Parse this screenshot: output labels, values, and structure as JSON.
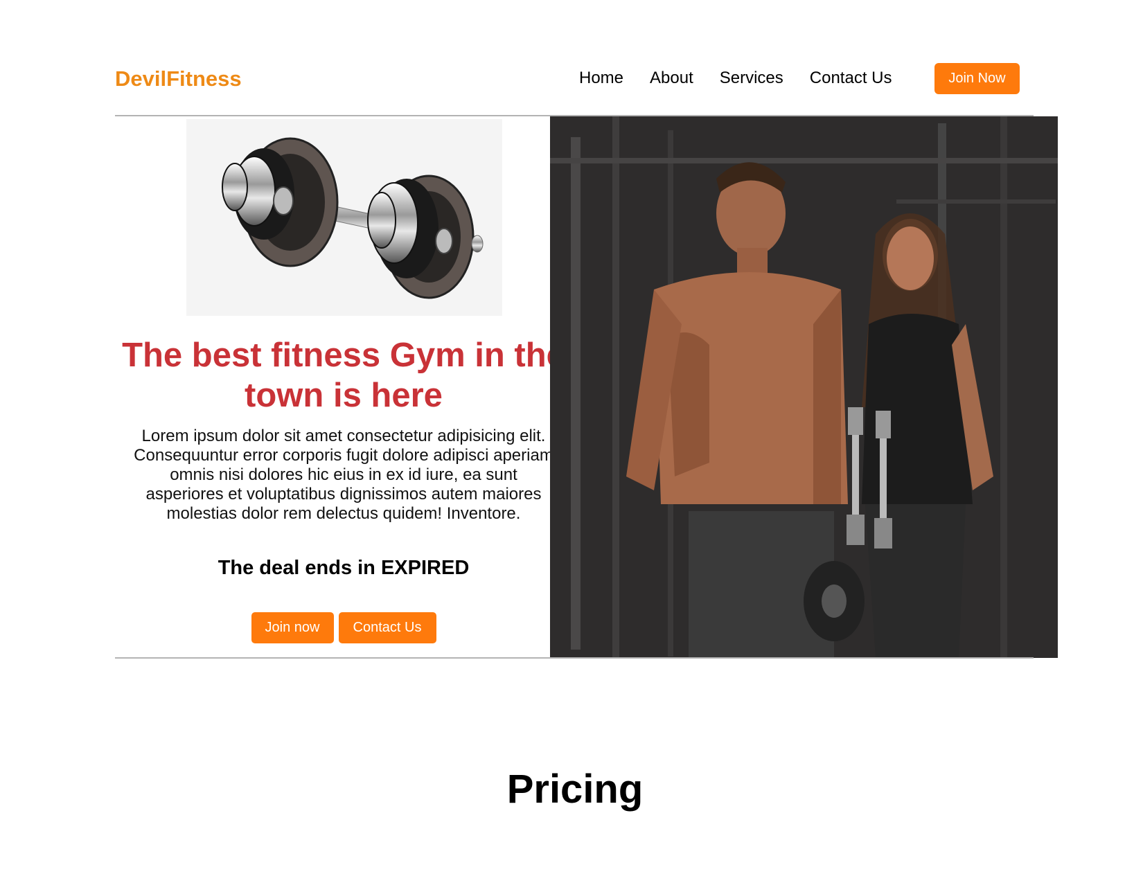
{
  "brand": {
    "name": "DevilFitness"
  },
  "nav": {
    "links": [
      "Home",
      "About",
      "Services",
      "Contact Us"
    ],
    "join_label": "Join Now"
  },
  "hero": {
    "title": "The best fitness Gym in the town is here",
    "text": "Lorem ipsum dolor sit amet consectetur adipisicing elit. Consequuntur error corporis fugit dolore adipisci aperiam omnis nisi dolores hic eius in ex id iure, ea sunt asperiores et voluptatibus dignissimos autem maiores molestias dolor rem delectus quidem! Inventore.",
    "deal_prefix": "The deal ends in",
    "deal_status": "EXPIRED",
    "join_button": "Join now",
    "contact_button": "Contact Us"
  },
  "pricing": {
    "title": "Pricing"
  },
  "colors": {
    "accent": "#fe7a0c",
    "brand": "#ee8a16",
    "headline": "#c93237"
  }
}
